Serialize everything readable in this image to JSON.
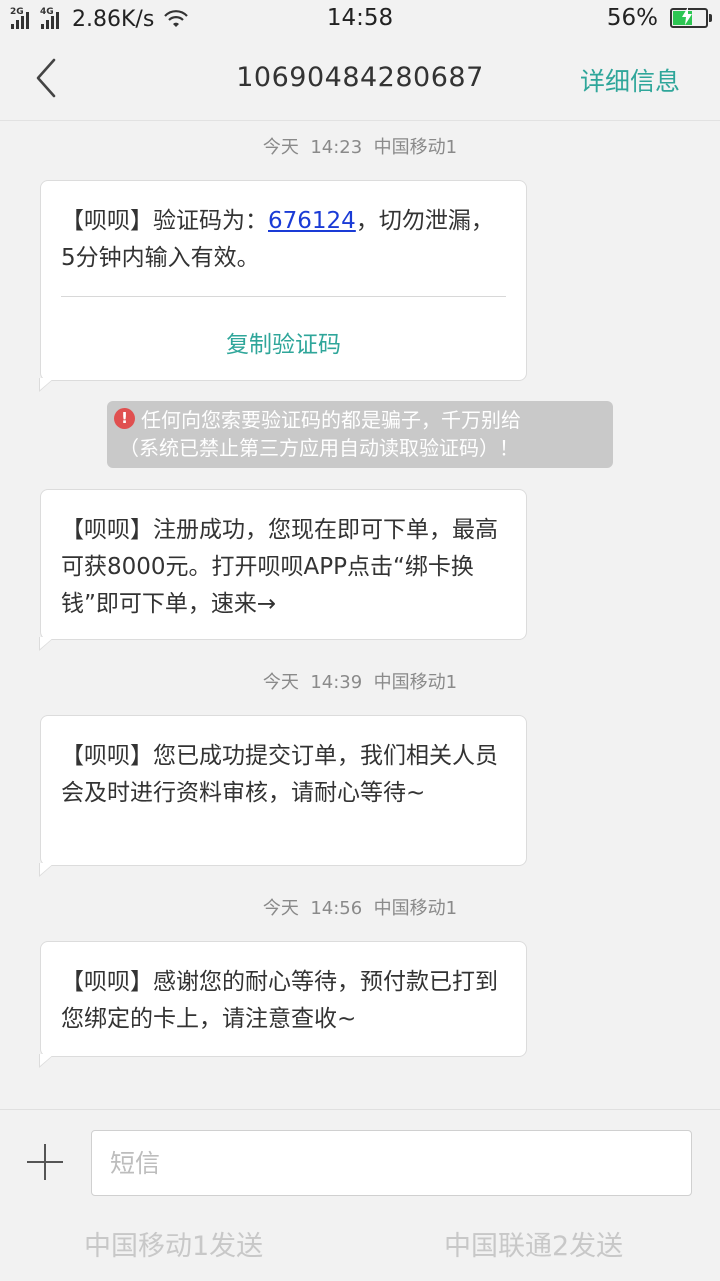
{
  "status_bar": {
    "net1": "2G",
    "net2": "4G",
    "speed": "2.86K/s",
    "time": "14:58",
    "battery_pct": "56%",
    "battery_level": 0.56
  },
  "header": {
    "title": "10690484280687",
    "details_label": "详细信息"
  },
  "messages": [
    {
      "timestamp": {
        "day": "今天",
        "time": "14:23",
        "carrier": "中国移动1"
      },
      "text_before": "【呗呗】验证码为：",
      "code": "676124",
      "text_after": "，切勿泄漏，5分钟内输入有效。",
      "copy_label": "复制验证码"
    },
    {
      "text": "【呗呗】注册成功，您现在即可下单，最高可获8000元。打开呗呗APP点击“绑卡换钱”即可下单，速来→"
    },
    {
      "timestamp": {
        "day": "今天",
        "time": "14:39",
        "carrier": "中国移动1"
      },
      "text": "【呗呗】您已成功提交订单，我们相关人员会及时进行资料审核，请耐心等待~"
    },
    {
      "timestamp": {
        "day": "今天",
        "time": "14:56",
        "carrier": "中国移动1"
      },
      "text": "【呗呗】感谢您的耐心等待，预付款已打到您绑定的卡上，请注意查收~"
    }
  ],
  "warning": {
    "icon": "!",
    "line1": "任何向您索要验证码的都是骗子，千万别给",
    "line2": "（系统已禁止第三方应用自动读取验证码）！"
  },
  "compose": {
    "placeholder": "短信",
    "send_sim1": "中国移动1发送",
    "send_sim2": "中国联通2发送"
  },
  "colors": {
    "accent": "#2fa69a",
    "code_link": "#1a3bd6",
    "warning_bg": "#c9c9c9",
    "warning_icon": "#e05050",
    "battery_fill": "#2dc653"
  }
}
